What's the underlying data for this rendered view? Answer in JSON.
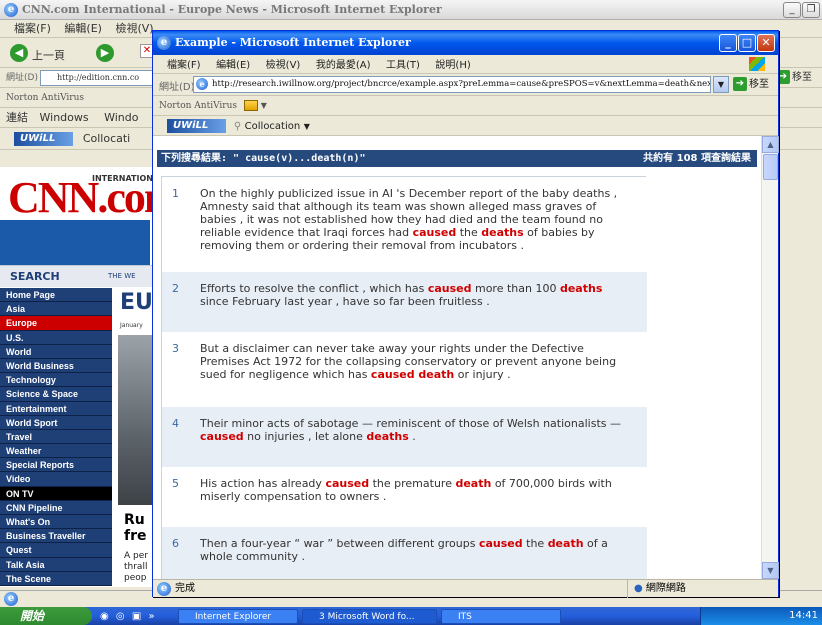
{
  "bg_window": {
    "title": "CNN.com International - Europe News - Microsoft Internet Explorer",
    "menu": [
      "檔案(F)",
      "編輯(E)",
      "檢視(V)"
    ],
    "back_label": "上一頁",
    "address_label": "網址(D)",
    "address_value": "http://edition.cnn.co",
    "norton_label": "Norton AntiVirus",
    "links_label": "連結",
    "links": [
      "Windows",
      "Windo"
    ],
    "collocation_label": "Collocati",
    "go_label": "移至",
    "cnn_international": "INTERNATIONAL",
    "search_label": "SEARCH",
    "search_option": "THE WE",
    "headline_fragment": "EU",
    "date_fragment": "January",
    "story_headline_1": "Ru",
    "story_headline_2": "fre",
    "story_text": [
      "A per",
      "thrall",
      "peop"
    ],
    "nav_items": [
      "Home Page",
      "Asia",
      "Europe",
      "U.S.",
      "World",
      "World Business",
      "Technology",
      "Science & Space",
      "Entertainment",
      "World Sport",
      "Travel",
      "Weather",
      "Special Reports",
      "Video"
    ],
    "nav_active": "Europe",
    "on_tv_label": "ON TV",
    "tv_items": [
      "CNN Pipeline",
      "What's On",
      "Business Traveller",
      "Quest",
      "Talk Asia",
      "The Scene"
    ]
  },
  "front_window": {
    "title": "Example - Microsoft Internet Explorer",
    "menu": [
      "檔案(F)",
      "編輯(E)",
      "檢視(V)",
      "我的最愛(A)",
      "工具(T)",
      "說明(H)"
    ],
    "address_label": "網址(D)",
    "address_value": "http://research.iwillnow.org/project/bncrce/example.aspx?preLemma=cause&preSPOS=v&nextLemma=death&nextSPOS=n",
    "go_label": "移至",
    "norton_label": "Norton AntiVirus",
    "uwill_label": "UWiLL",
    "collocation_label": "Collocation",
    "status_text": "完成",
    "zone_text": "網際網路"
  },
  "results": {
    "header": "下列搜尋結果: \" cause(v)...death(n)\"",
    "count": "共約有 108 項查詢結果",
    "items": [
      {
        "num": "1",
        "segments": [
          {
            "t": "On the highly publicized issue in AI 's December report of the baby deaths , Amnesty said that although its team was shown alleged mass graves of babies , it was not established how they had died and the team found no reliable evidence that Iraqi forces had "
          },
          {
            "t": "caused",
            "hl": true
          },
          {
            "t": " the "
          },
          {
            "t": "deaths",
            "hl": true
          },
          {
            "t": " of babies by removing them or ordering their removal from incubators ."
          }
        ]
      },
      {
        "num": "2",
        "segments": [
          {
            "t": "Efforts to resolve the conflict , which has "
          },
          {
            "t": "caused",
            "hl": true
          },
          {
            "t": " more than 100 "
          },
          {
            "t": "deaths",
            "hl": true
          },
          {
            "t": " since February last year , have so far been fruitless ."
          }
        ]
      },
      {
        "num": "3",
        "segments": [
          {
            "t": "But a disclaimer can never take away your rights under the Defective Premises Act 1972 for the collapsing conservatory or prevent anyone being sued for negligence which has "
          },
          {
            "t": "caused death",
            "hl": true
          },
          {
            "t": " or injury ."
          }
        ]
      },
      {
        "num": "4",
        "segments": [
          {
            "t": "Their minor acts of sabotage — reminiscent of those of Welsh nationalists — "
          },
          {
            "t": "caused",
            "hl": true
          },
          {
            "t": " no injuries , let alone "
          },
          {
            "t": "deaths",
            "hl": true
          },
          {
            "t": " ."
          }
        ]
      },
      {
        "num": "5",
        "segments": [
          {
            "t": "His action has already "
          },
          {
            "t": "caused",
            "hl": true
          },
          {
            "t": " the premature "
          },
          {
            "t": "death",
            "hl": true
          },
          {
            "t": " of 700,000 birds with miserly compensation to owners ."
          }
        ]
      },
      {
        "num": "6",
        "segments": [
          {
            "t": "Then a four-year “ war ” between different groups "
          },
          {
            "t": "caused",
            "hl": true
          },
          {
            "t": " the "
          },
          {
            "t": "death",
            "hl": true
          },
          {
            "t": " of a whole community ."
          }
        ]
      }
    ]
  },
  "taskbar": {
    "start_label": "開始",
    "tasks": [
      "Internet Explorer",
      "3 Microsoft Word fo...",
      "ITS"
    ],
    "clock": "14:41"
  }
}
